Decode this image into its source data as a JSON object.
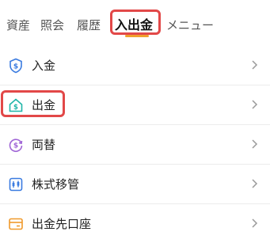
{
  "tabs": [
    {
      "label": "資産"
    },
    {
      "label": "照会"
    },
    {
      "label": "履歴"
    },
    {
      "label": "入出金",
      "selected": true
    },
    {
      "label": "メニュー"
    }
  ],
  "menu": {
    "items": [
      {
        "label": "入金",
        "icon": "deposit-shield-icon"
      },
      {
        "label": "出金",
        "icon": "withdraw-house-icon",
        "highlighted": true
      },
      {
        "label": "両替",
        "icon": "exchange-circle-icon"
      },
      {
        "label": "株式移管",
        "icon": "stock-transfer-icon"
      },
      {
        "label": "出金先口座",
        "icon": "bank-account-card-icon"
      }
    ]
  },
  "colors": {
    "highlight": "#e24848",
    "tab_underline": "#f0a02c",
    "deposit_icon": "#3a7be0",
    "withdraw_icon": "#1fb5a8",
    "exchange_icon": "#a066d6",
    "transfer_icon": "#3a7be0",
    "account_icon": "#f09a2c"
  }
}
